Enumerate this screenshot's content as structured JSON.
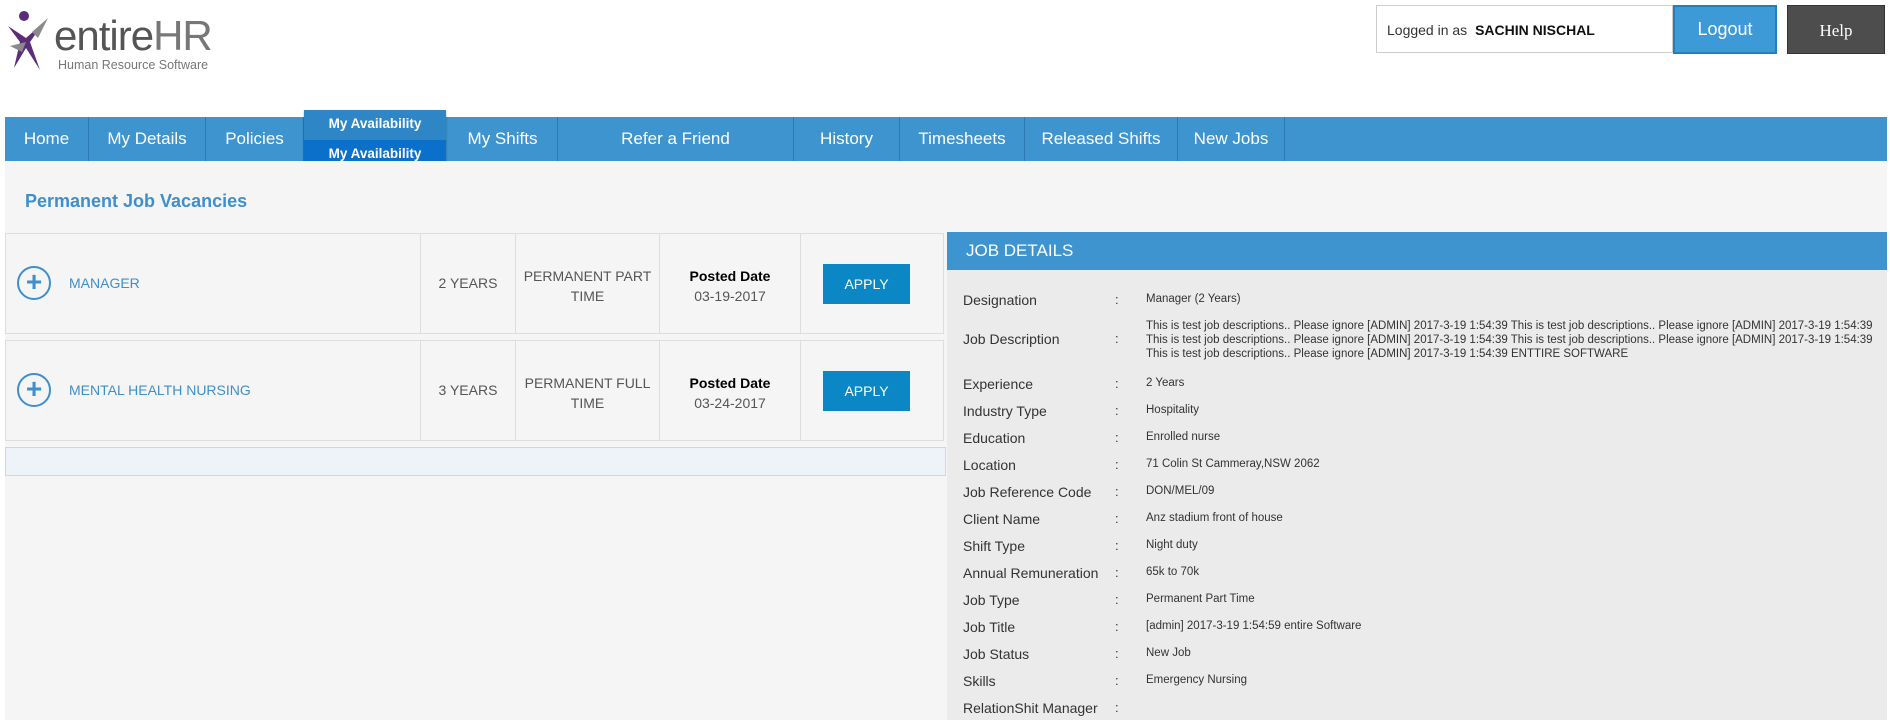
{
  "brand": {
    "name_main": "entire",
    "name_hr": "HR",
    "tagline": "Human Resource Software",
    "colors": {
      "accent": "#3d94cf",
      "logo_purple": "#5b2c7a"
    }
  },
  "header": {
    "logged_in_label": "Logged in as",
    "username": "SACHIN NISCHAL",
    "logout_label": "Logout",
    "help_label": "Help"
  },
  "nav": {
    "items": [
      {
        "label": "Home"
      },
      {
        "label": "My Details"
      },
      {
        "label": "Policies"
      },
      {
        "label": "My Availability",
        "sub": "My Availability"
      },
      {
        "label": "My Shifts"
      },
      {
        "label": "Refer a Friend"
      },
      {
        "label": "History"
      },
      {
        "label": "Timesheets"
      },
      {
        "label": "Released Shifts"
      },
      {
        "label": "New Jobs"
      }
    ]
  },
  "page": {
    "title": "Permanent Job Vacancies"
  },
  "jobs": [
    {
      "title": "MANAGER",
      "experience": "2 YEARS",
      "type_line1": "PERMANENT PART",
      "type_line2": "TIME",
      "posted_label": "Posted Date",
      "posted_date": "03-19-2017",
      "apply_label": "APPLY"
    },
    {
      "title": "MENTAL HEALTH NURSING",
      "experience": "3 YEARS",
      "type_line1": "PERMANENT FULL",
      "type_line2": "TIME",
      "posted_label": "Posted Date",
      "posted_date": "03-24-2017",
      "apply_label": "APPLY"
    }
  ],
  "details": {
    "header": "JOB DETAILS",
    "separator": ":",
    "rows": [
      {
        "label": "Designation",
        "value": "Manager (2 Years)"
      },
      {
        "label": "Job Description",
        "value": "This is test job descriptions.. Please ignore [ADMIN] 2017-3-19 1:54:39 This is test job descriptions.. Please ignore [ADMIN] 2017-3-19 1:54:39 This is test job descriptions.. Please ignore [ADMIN] 2017-3-19 1:54:39 This is test job descriptions.. Please ignore [ADMIN] 2017-3-19 1:54:39 This is test job descriptions.. Please ignore [ADMIN] 2017-3-19 1:54:39 ENTTIRE SOFTWARE"
      },
      {
        "label": "Experience",
        "value": "2 Years"
      },
      {
        "label": "Industry Type",
        "value": "Hospitality"
      },
      {
        "label": "Education",
        "value": "Enrolled nurse"
      },
      {
        "label": "Location",
        "value": "71 Colin St Cammeray,NSW 2062"
      },
      {
        "label": "Job Reference Code",
        "value": "DON/MEL/09"
      },
      {
        "label": "Client Name",
        "value": "Anz stadium front of house"
      },
      {
        "label": "Shift Type",
        "value": "Night duty"
      },
      {
        "label": "Annual Remuneration",
        "value": "65k to 70k"
      },
      {
        "label": "Job Type",
        "value": "Permanent Part Time"
      },
      {
        "label": "Job Title",
        "value": "[admin] 2017-3-19 1:54:59 entire Software"
      },
      {
        "label": "Job Status",
        "value": "New Job"
      },
      {
        "label": "Skills",
        "value": "Emergency Nursing"
      },
      {
        "label": "RelationShit Manager",
        "value": ""
      }
    ]
  }
}
